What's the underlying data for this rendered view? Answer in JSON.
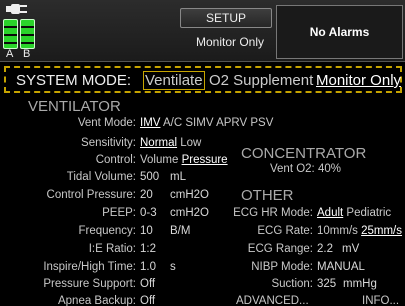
{
  "battery": {
    "labels": [
      "A",
      "B"
    ]
  },
  "header": {
    "setup_label": "SETUP",
    "mode_text": "Monitor Only",
    "alarm_text": "No Alarms"
  },
  "system_mode": {
    "label": "SYSTEM MODE:",
    "options": [
      "Ventilate",
      "O2 Supplement",
      "Monitor Only"
    ],
    "selected": "Monitor Only"
  },
  "ventilator": {
    "title": "VENTILATOR",
    "vent_mode": {
      "label": "Vent Mode:",
      "options": [
        "IMV",
        "A/C",
        "SIMV",
        "APRV",
        "PSV"
      ],
      "selected": "IMV"
    },
    "sensitivity": {
      "label": "Sensitivity:",
      "options": [
        "Normal",
        "Low"
      ],
      "selected": "Normal"
    },
    "control": {
      "label": "Control:",
      "options": [
        "Volume",
        "Pressure"
      ],
      "selected": "Pressure"
    },
    "tidal_volume": {
      "label": "Tidal Volume:",
      "value": "500",
      "unit": "mL"
    },
    "control_pressure": {
      "label": "Control Pressure:",
      "value": "20",
      "unit": "cmH2O"
    },
    "peep": {
      "label": "PEEP:",
      "value": "0-3",
      "unit": "cmH2O"
    },
    "frequency": {
      "label": "Frequency:",
      "value": "10",
      "unit": "B/M"
    },
    "ie_ratio": {
      "label": "I:E Ratio:",
      "value": "1:2"
    },
    "inspire_time": {
      "label": "Inspire/High Time:",
      "value": "1.0",
      "unit": "s"
    },
    "pressure_support": {
      "label": "Pressure Support:",
      "value": "Off"
    },
    "apnea_backup": {
      "label": "Apnea Backup:",
      "value": "Off"
    }
  },
  "concentrator": {
    "title": "CONCENTRATOR",
    "vent_o2": "Vent O2: 40%"
  },
  "other": {
    "title": "OTHER",
    "ecg_hr_mode": {
      "label": "ECG HR Mode:",
      "options": [
        "Adult",
        "Pediatric"
      ],
      "selected": "Adult"
    },
    "ecg_rate": {
      "label": "ECG Rate:",
      "options": [
        "10mm/s",
        "25mm/s"
      ],
      "selected": "25mm/s"
    },
    "ecg_range": {
      "label": "ECG Range:",
      "value": "2.2",
      "unit": "mV"
    },
    "nibp_mode": {
      "label": "NIBP Mode:",
      "value": "MANUAL"
    },
    "suction": {
      "label": "Suction:",
      "value": "325",
      "unit": "mmHg"
    },
    "advanced_label": "ADVANCED...",
    "info_label": "INFO..."
  },
  "colors": {
    "battery_green": "#2ad32a",
    "mode_border": "#c6a400",
    "background": "#000000"
  },
  "icons": [
    "power-plug-icon",
    "battery-icon"
  ]
}
